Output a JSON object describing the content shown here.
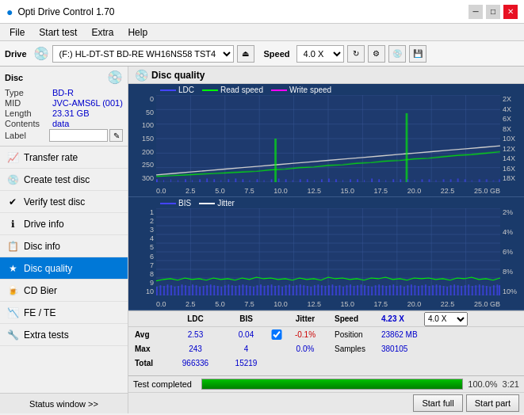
{
  "titlebar": {
    "title": "Opti Drive Control 1.70",
    "icon": "●",
    "minimize": "─",
    "maximize": "□",
    "close": "✕"
  },
  "menubar": {
    "items": [
      "File",
      "Start test",
      "Extra",
      "Help"
    ]
  },
  "drivetoolbar": {
    "drive_label": "Drive",
    "drive_value": "(F:) HL-DT-ST BD-RE WH16NS58 TST4",
    "speed_label": "Speed",
    "speed_value": "4.0 X"
  },
  "disc": {
    "title": "Disc",
    "type_label": "Type",
    "type_val": "BD-R",
    "mid_label": "MID",
    "mid_val": "JVC-AMS6L (001)",
    "length_label": "Length",
    "length_val": "23.31 GB",
    "contents_label": "Contents",
    "contents_val": "data",
    "label_label": "Label",
    "label_placeholder": ""
  },
  "nav": {
    "items": [
      {
        "id": "transfer-rate",
        "label": "Transfer rate",
        "icon": "📈"
      },
      {
        "id": "create-test-disc",
        "label": "Create test disc",
        "icon": "💿"
      },
      {
        "id": "verify-test-disc",
        "label": "Verify test disc",
        "icon": "✔"
      },
      {
        "id": "drive-info",
        "label": "Drive info",
        "icon": "ℹ"
      },
      {
        "id": "disc-info",
        "label": "Disc info",
        "icon": "📋"
      },
      {
        "id": "disc-quality",
        "label": "Disc quality",
        "icon": "★",
        "active": true
      },
      {
        "id": "cd-bier",
        "label": "CD Bier",
        "icon": "🍺"
      },
      {
        "id": "fe-te",
        "label": "FE / TE",
        "icon": "📉"
      },
      {
        "id": "extra-tests",
        "label": "Extra tests",
        "icon": "🔧"
      }
    ],
    "status_btn": "Status window >>"
  },
  "content": {
    "title": "Disc quality",
    "icon": "💿"
  },
  "chart1": {
    "title": "LDC",
    "legend": [
      {
        "label": "LDC",
        "color": "#0000ff"
      },
      {
        "label": "Read speed",
        "color": "#00ff00"
      },
      {
        "label": "Write speed",
        "color": "#ff00ff"
      }
    ],
    "y_left": [
      "300",
      "250",
      "200",
      "150",
      "100",
      "50",
      "0"
    ],
    "y_right": [
      "18X",
      "16X",
      "14X",
      "12X",
      "10X",
      "8X",
      "6X",
      "4X",
      "2X"
    ],
    "x_labels": [
      "0.0",
      "2.5",
      "5.0",
      "7.5",
      "10.0",
      "12.5",
      "15.0",
      "17.5",
      "20.0",
      "22.5",
      "25.0 GB"
    ]
  },
  "chart2": {
    "title": "BIS",
    "legend": [
      {
        "label": "BIS",
        "color": "#0000ff"
      },
      {
        "label": "Jitter",
        "color": "#ffffff"
      }
    ],
    "y_left": [
      "10",
      "9",
      "8",
      "7",
      "6",
      "5",
      "4",
      "3",
      "2",
      "1"
    ],
    "y_right": [
      "10%",
      "8%",
      "6%",
      "4%",
      "2%"
    ],
    "x_labels": [
      "0.0",
      "2.5",
      "5.0",
      "7.5",
      "10.0",
      "12.5",
      "15.0",
      "17.5",
      "20.0",
      "22.5",
      "25.0 GB"
    ]
  },
  "stats": {
    "headers": [
      "",
      "LDC",
      "BIS",
      "",
      "Jitter",
      "Speed",
      "",
      ""
    ],
    "avg_label": "Avg",
    "avg_ldc": "2.53",
    "avg_bis": "0.04",
    "avg_jitter": "-0.1%",
    "max_label": "Max",
    "max_ldc": "243",
    "max_bis": "4",
    "max_jitter": "0.0%",
    "total_label": "Total",
    "total_ldc": "966336",
    "total_bis": "15219",
    "jitter_checked": true,
    "jitter_label": "Jitter",
    "speed_label": "Speed",
    "speed_val": "4.23 X",
    "speed_select": "4.0 X",
    "position_label": "Position",
    "position_val": "23862 MB",
    "samples_label": "Samples",
    "samples_val": "380105"
  },
  "bottombar": {
    "progress": 100,
    "progress_text": "100.0%",
    "time_text": "3:21",
    "status_text": "Test completed",
    "start_full_label": "Start full",
    "start_part_label": "Start part"
  }
}
